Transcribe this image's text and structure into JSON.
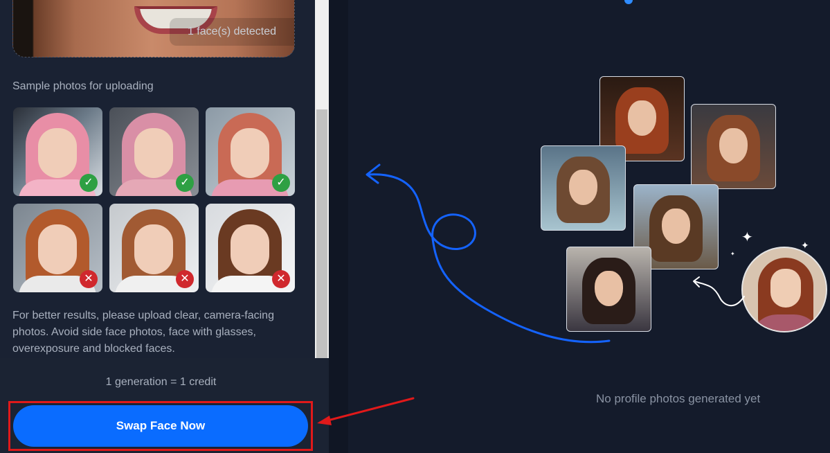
{
  "upload": {
    "face_status": "1 face(s) detected"
  },
  "samples": {
    "title": "Sample photos for uploading",
    "items": [
      {
        "status": "ok",
        "icon": "check-icon"
      },
      {
        "status": "ok",
        "icon": "check-icon"
      },
      {
        "status": "ok",
        "icon": "check-icon"
      },
      {
        "status": "bad",
        "icon": "cross-icon"
      },
      {
        "status": "bad",
        "icon": "cross-icon"
      },
      {
        "status": "bad",
        "icon": "cross-icon"
      }
    ],
    "tip": "For better results, please upload clear, camera-facing photos. Avoid side face photos, face with glasses, overexposure and blocked faces."
  },
  "footer": {
    "credit_note": "1 generation = 1 credit",
    "swap_button": "Swap Face Now"
  },
  "results": {
    "empty_message": "No profile photos generated yet"
  },
  "colors": {
    "primary": "#0a6cff",
    "ok": "#2ea043",
    "bad": "#d0282d",
    "annotation": "#e0191a",
    "curve": "#1463ff"
  }
}
